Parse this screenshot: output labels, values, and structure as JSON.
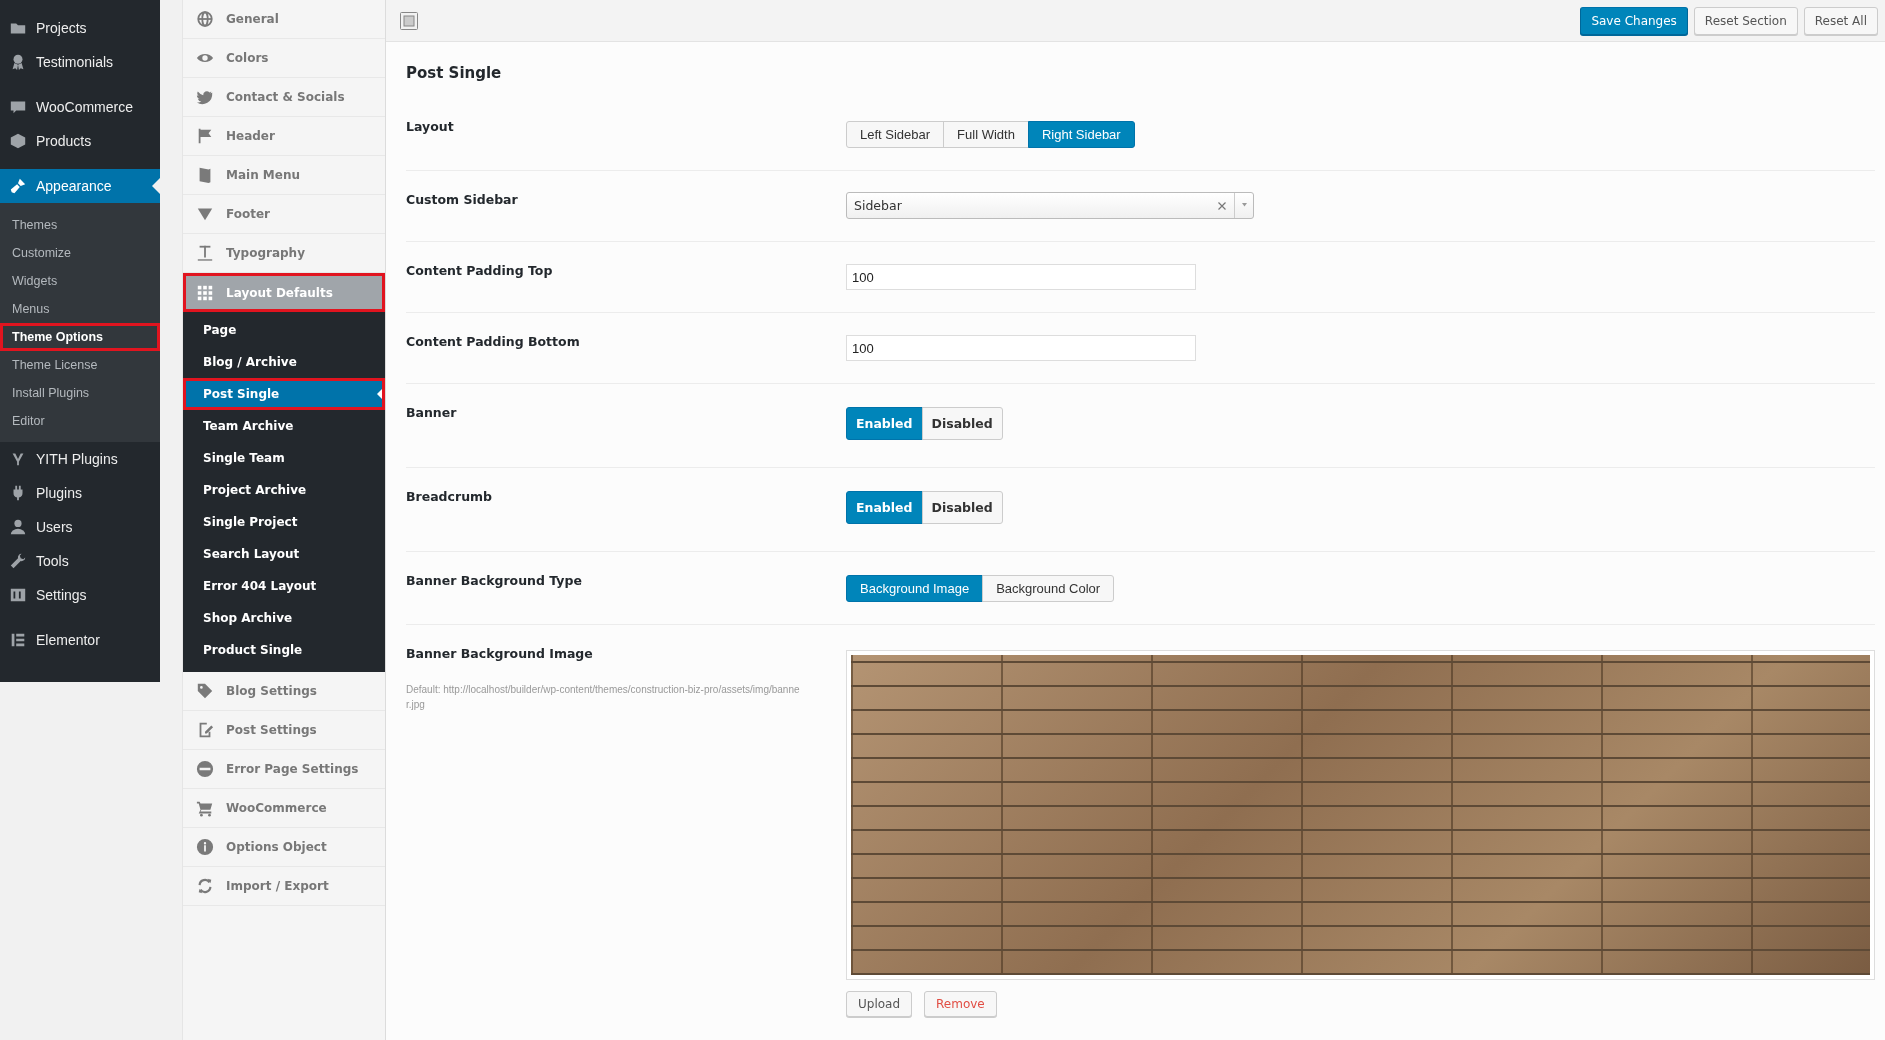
{
  "admin_menu": {
    "groups": [
      {
        "items": [
          {
            "label": "Projects",
            "selected": false
          },
          {
            "label": "Testimonials",
            "selected": false
          }
        ]
      },
      {
        "items": [
          {
            "label": "WooCommerce",
            "selected": false
          },
          {
            "label": "Products",
            "selected": false
          }
        ]
      },
      {
        "items": [
          {
            "label": "Appearance",
            "selected": true,
            "children": [
              {
                "label": "Themes",
                "selected": false,
                "highlighted": false
              },
              {
                "label": "Customize",
                "selected": false,
                "highlighted": false
              },
              {
                "label": "Widgets",
                "selected": false,
                "highlighted": false
              },
              {
                "label": "Menus",
                "selected": false,
                "highlighted": false
              },
              {
                "label": "Theme Options",
                "selected": true,
                "highlighted": true
              },
              {
                "label": "Theme License",
                "selected": false,
                "highlighted": false
              },
              {
                "label": "Install Plugins",
                "selected": false,
                "highlighted": false
              },
              {
                "label": "Editor",
                "selected": false,
                "highlighted": false
              }
            ]
          },
          {
            "label": "YITH Plugins",
            "selected": false
          },
          {
            "label": "Plugins",
            "selected": false
          },
          {
            "label": "Users",
            "selected": false
          },
          {
            "label": "Tools",
            "selected": false
          },
          {
            "label": "Settings",
            "selected": false
          }
        ]
      },
      {
        "items": [
          {
            "label": "Elementor",
            "selected": false
          }
        ]
      }
    ]
  },
  "options_nav": {
    "sections": [
      {
        "label": "General",
        "expanded": false,
        "highlighted": false
      },
      {
        "label": "Colors",
        "expanded": false,
        "highlighted": false
      },
      {
        "label": "Contact & Socials",
        "expanded": false,
        "highlighted": false
      },
      {
        "label": "Header",
        "expanded": false,
        "highlighted": false
      },
      {
        "label": "Main Menu",
        "expanded": false,
        "highlighted": false
      },
      {
        "label": "Footer",
        "expanded": false,
        "highlighted": false
      },
      {
        "label": "Typography",
        "expanded": false,
        "highlighted": false
      },
      {
        "label": "Layout Defaults",
        "expanded": true,
        "highlighted": true,
        "children": [
          {
            "label": "Page",
            "selected": false,
            "highlighted": false
          },
          {
            "label": "Blog / Archive",
            "selected": false,
            "highlighted": false
          },
          {
            "label": "Post Single",
            "selected": true,
            "highlighted": true
          },
          {
            "label": "Team Archive",
            "selected": false,
            "highlighted": false
          },
          {
            "label": "Single Team",
            "selected": false,
            "highlighted": false
          },
          {
            "label": "Project Archive",
            "selected": false,
            "highlighted": false
          },
          {
            "label": "Single Project",
            "selected": false,
            "highlighted": false
          },
          {
            "label": "Search Layout",
            "selected": false,
            "highlighted": false
          },
          {
            "label": "Error 404 Layout",
            "selected": false,
            "highlighted": false
          },
          {
            "label": "Shop Archive",
            "selected": false,
            "highlighted": false
          },
          {
            "label": "Product Single",
            "selected": false,
            "highlighted": false
          }
        ]
      },
      {
        "label": "Blog Settings",
        "expanded": false,
        "highlighted": false
      },
      {
        "label": "Post Settings",
        "expanded": false,
        "highlighted": false
      },
      {
        "label": "Error Page Settings",
        "expanded": false,
        "highlighted": false
      },
      {
        "label": "WooCommerce",
        "expanded": false,
        "highlighted": false
      },
      {
        "label": "Options Object",
        "expanded": false,
        "highlighted": false
      },
      {
        "label": "Import / Export",
        "expanded": false,
        "highlighted": false
      }
    ]
  },
  "toolbar": {
    "buttons": [
      {
        "label": "Save Changes",
        "kind": "primary"
      },
      {
        "label": "Reset Section",
        "kind": "secondary"
      },
      {
        "label": "Reset All",
        "kind": "secondary"
      }
    ]
  },
  "panel": {
    "title": "Post Single",
    "fields": [
      {
        "label": "Layout",
        "kind": "buttonset",
        "options": [
          {
            "label": "Left Sidebar",
            "selected": false
          },
          {
            "label": "Full Width",
            "selected": false
          },
          {
            "label": "Right Sidebar",
            "selected": true
          }
        ]
      },
      {
        "label": "Custom Sidebar",
        "kind": "select",
        "value": "Sidebar"
      },
      {
        "label": "Content Padding Top",
        "kind": "text",
        "value": "100"
      },
      {
        "label": "Content Padding Bottom",
        "kind": "text",
        "value": "100"
      },
      {
        "label": "Banner",
        "kind": "switch",
        "options": [
          {
            "label": "Enabled",
            "selected": true
          },
          {
            "label": "Disabled",
            "selected": false
          }
        ]
      },
      {
        "label": "Breadcrumb",
        "kind": "switch",
        "options": [
          {
            "label": "Enabled",
            "selected": true
          },
          {
            "label": "Disabled",
            "selected": false
          }
        ]
      },
      {
        "label": "Banner Background Type",
        "kind": "buttonset",
        "options": [
          {
            "label": "Background Image",
            "selected": true
          },
          {
            "label": "Background Color",
            "selected": false
          }
        ]
      },
      {
        "label": "Banner Background Image",
        "kind": "media",
        "description": "Default: http://localhost/builder/wp-content/themes/construction-biz-pro/assets/img/banner.jpg",
        "buttons": [
          {
            "label": "Upload",
            "kind": "secondary"
          },
          {
            "label": "Remove",
            "kind": "danger"
          }
        ]
      }
    ]
  }
}
